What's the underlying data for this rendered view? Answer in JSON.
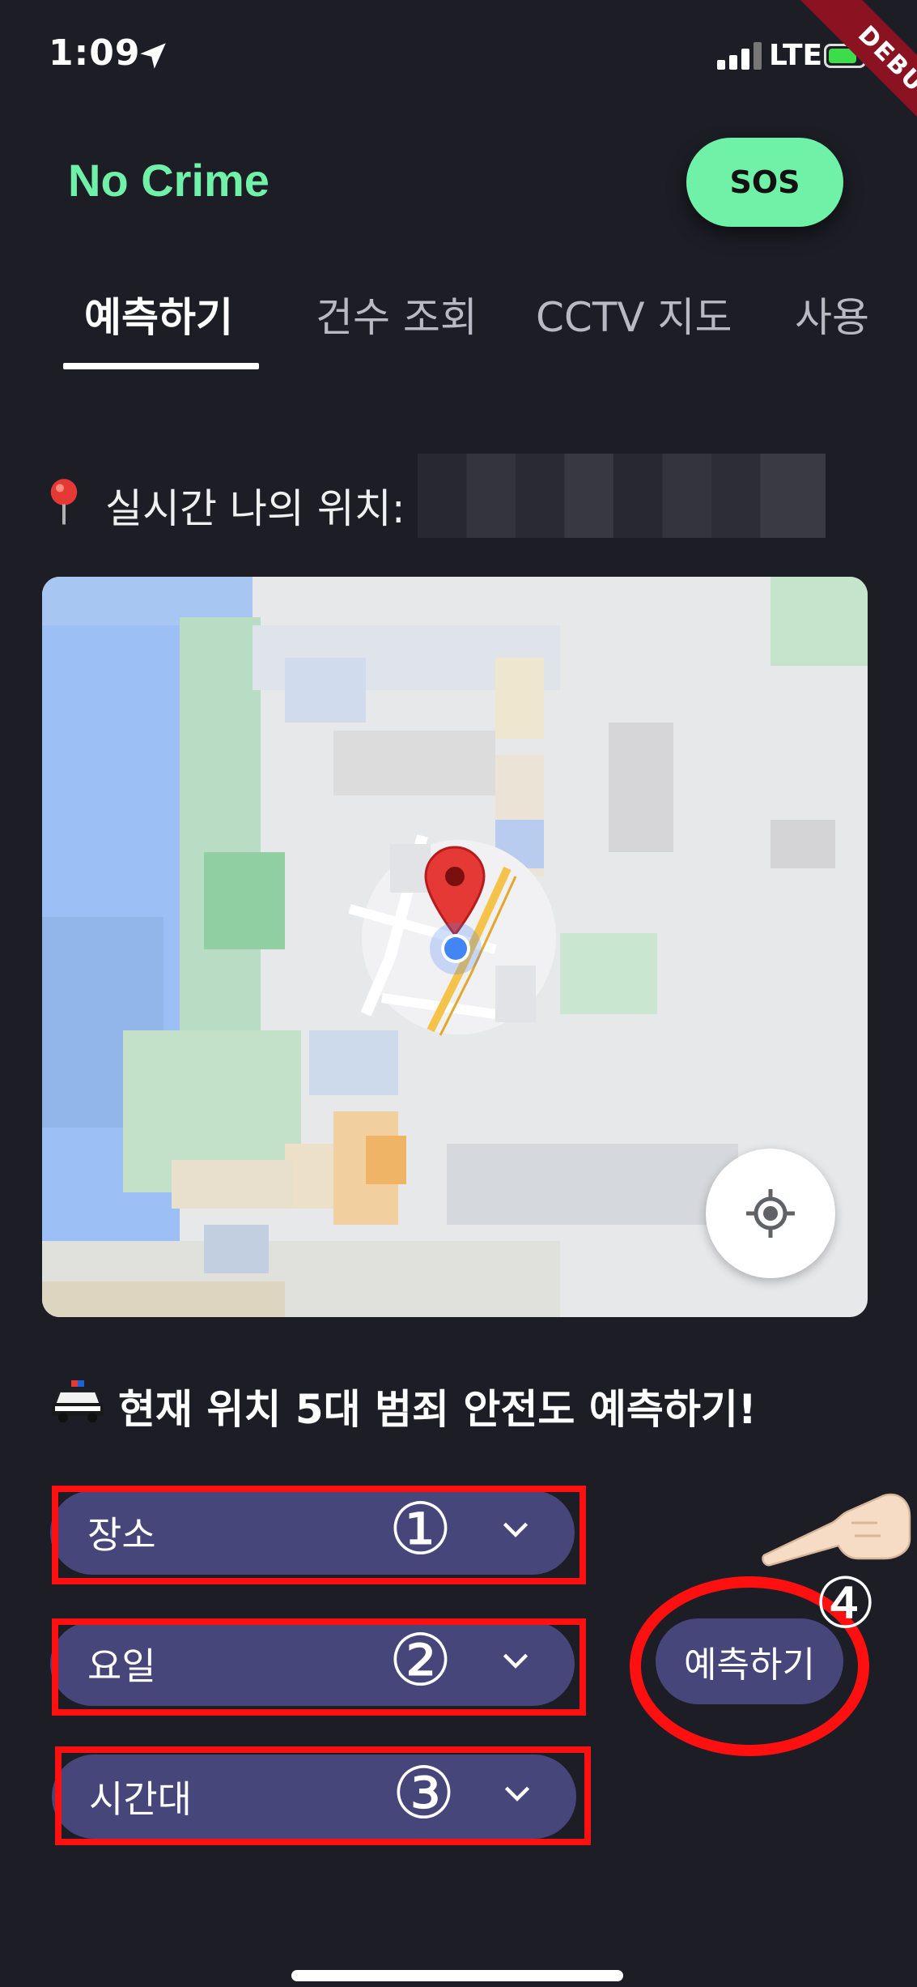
{
  "status_bar": {
    "time": "1:09",
    "network": "LTE"
  },
  "debug_banner": "DEBUG",
  "header": {
    "app_title": "No Crime",
    "sos_label": "SOS"
  },
  "tabs": [
    {
      "label": "예측하기",
      "active": true
    },
    {
      "label": "건수 조회",
      "active": false
    },
    {
      "label": "CCTV 지도",
      "active": false
    },
    {
      "label": "사용",
      "active": false
    }
  ],
  "location": {
    "label": "실시간 나의 위치:"
  },
  "prediction": {
    "heading": "현재 위치 5대 범죄 안전도 예측하기!",
    "dropdowns": [
      {
        "label": "장소",
        "step": "①"
      },
      {
        "label": "요일",
        "step": "②"
      },
      {
        "label": "시간대",
        "step": "③"
      }
    ],
    "button_label": "예측하기",
    "button_step": "④"
  },
  "colors": {
    "accent": "#6ff2a8",
    "background": "#1d1d26",
    "dropdown": "#47467a",
    "annotation": "#ff1010"
  }
}
